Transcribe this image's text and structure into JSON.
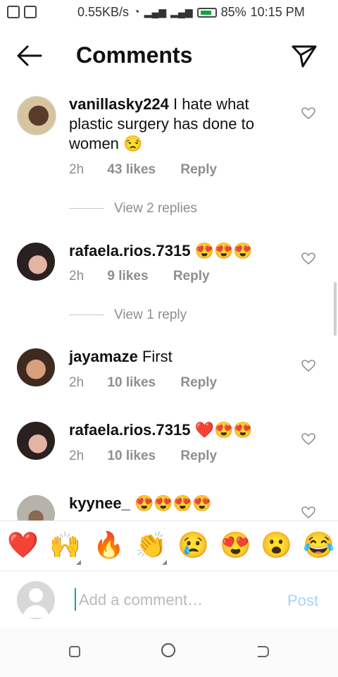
{
  "status_bar": {
    "speed": "0.55KB/s",
    "battery": "85%",
    "time": "10:15 PM"
  },
  "header": {
    "title": "Comments"
  },
  "comments": [
    {
      "username": "vanillasky224",
      "text": "I hate what plastic surgery has done to women",
      "emoji": "😒",
      "time": "2h",
      "likes": "43 likes",
      "reply": "Reply",
      "replies": "View 2 replies"
    },
    {
      "username": "rafaela.rios.7315",
      "text": "",
      "emoji": "😍😍😍",
      "time": "2h",
      "likes": "9 likes",
      "reply": "Reply",
      "replies": "View 1 reply"
    },
    {
      "username": "jayamaze",
      "text": "First",
      "emoji": "",
      "time": "2h",
      "likes": "10 likes",
      "reply": "Reply",
      "replies": ""
    },
    {
      "username": "rafaela.rios.7315",
      "text": "",
      "emoji": "❤️😍😍",
      "time": "2h",
      "likes": "10 likes",
      "reply": "Reply",
      "replies": ""
    },
    {
      "username": "kyynee_",
      "text": "",
      "emoji": "😍😍😍😍",
      "time": "",
      "likes": "",
      "reply": "",
      "replies": ""
    }
  ],
  "emoji_bar": [
    "❤️",
    "🙌",
    "🔥",
    "👏",
    "😢",
    "😍",
    "😮",
    "😂"
  ],
  "comment_box": {
    "placeholder": "Add a comment…",
    "post": "Post"
  },
  "colors": {
    "accent": "#0095f6",
    "post_disabled": "#a6d4ff",
    "muted": "#8e8e8e"
  }
}
